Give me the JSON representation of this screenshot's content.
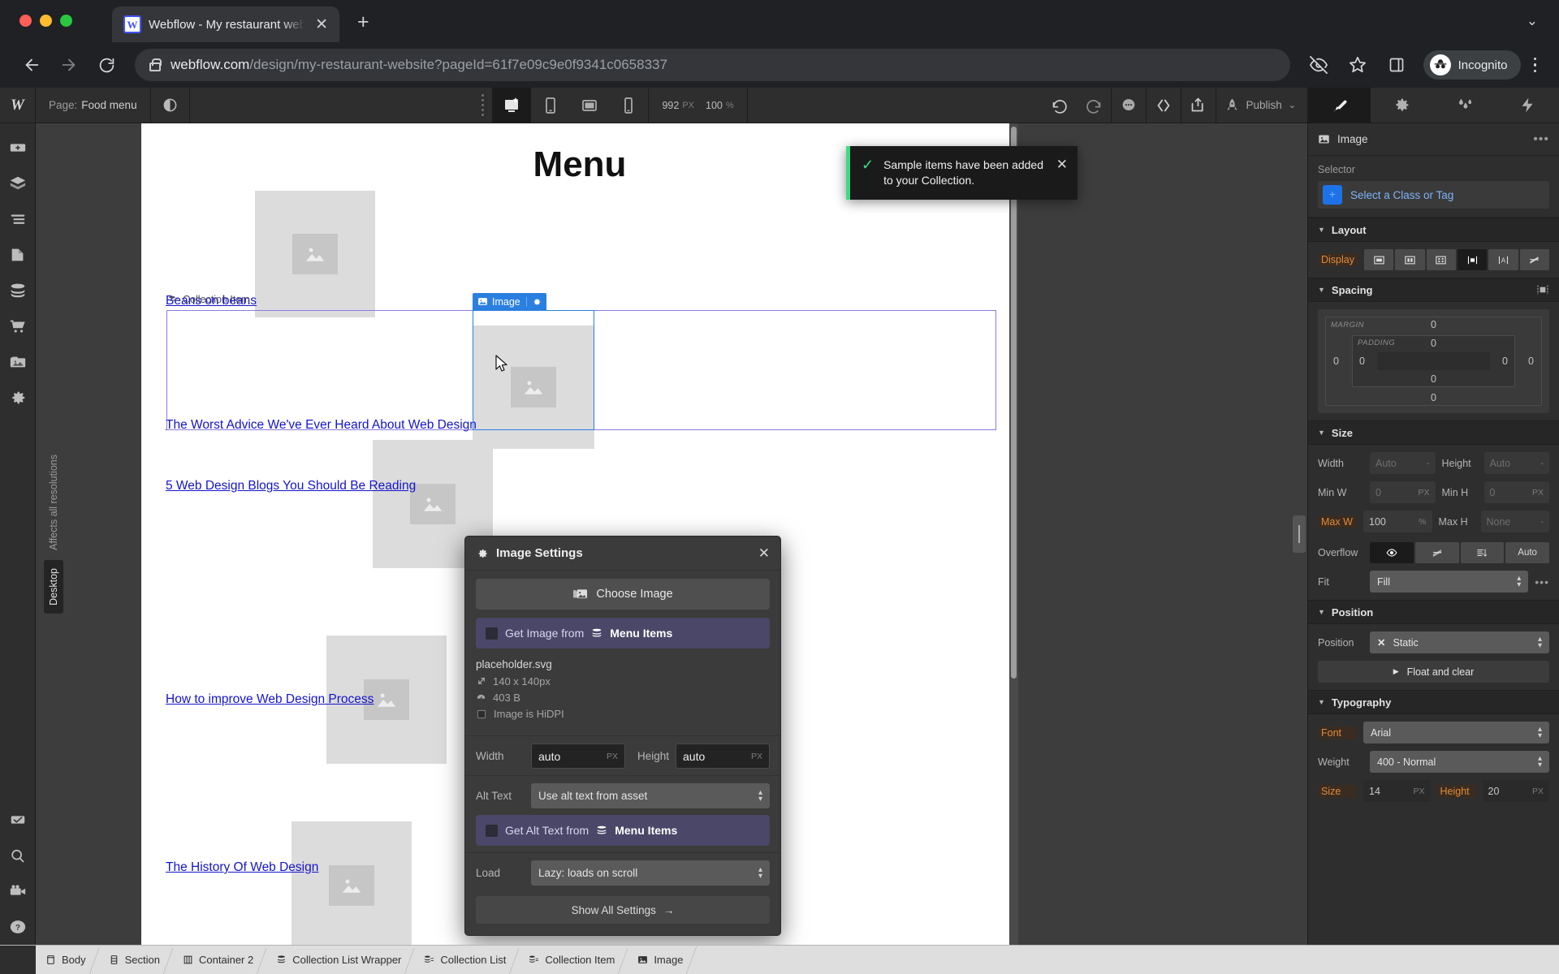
{
  "browser": {
    "tab": {
      "title": "Webflow - My restaurant webs",
      "favicon_letter": "W",
      "close_icon": "✕"
    },
    "new_tab_icon": "+",
    "window_chevron_icon": "⌄",
    "url_domain": "webflow.com",
    "url_path": "/design/my-restaurant-website?pageId=61f7e09c9e0f9341c0658337",
    "profile_label": "Incognito"
  },
  "toolbar": {
    "logo": "W",
    "page_prefix": "Page:",
    "page_name": "Food menu",
    "breakpoints": [
      "desktop",
      "tablet",
      "mobile-landscape",
      "mobile-portrait"
    ],
    "active_breakpoint": "desktop",
    "viewport_width": "992",
    "viewport_width_unit": "PX",
    "zoom": "100",
    "zoom_unit": "%",
    "publish_label": "Publish",
    "panel_tabs": [
      "style-panel",
      "settings-panel",
      "interactions-panel",
      "effects-panel"
    ],
    "active_panel_tab": "style-panel"
  },
  "left_rail": {
    "items": [
      "add-elements",
      "components",
      "navigator",
      "pages",
      "cms-collections",
      "ecommerce",
      "assets",
      "site-settings"
    ],
    "bottom_items": [
      "audit",
      "search",
      "video-tutorials",
      "help"
    ]
  },
  "breakpoint_label": {
    "affects": "Affects all resolutions",
    "current": "Desktop"
  },
  "canvas": {
    "title": "Menu",
    "items": [
      {
        "title": "Beans on beans"
      },
      {
        "title": "The Worst Advice We've Ever Heard About Web Design"
      },
      {
        "title": "5 Web Design Blogs You Should Be Reading"
      },
      {
        "title": "How to improve Web Design Process"
      },
      {
        "title": "The History Of Web Design"
      }
    ],
    "selection_badges": {
      "image": "Image",
      "collection_item": "Collection Item"
    }
  },
  "toast": {
    "message": "Sample items have been added to your Collection.",
    "check_icon": "✓",
    "close_icon": "✕"
  },
  "image_settings": {
    "title": "Image Settings",
    "close_icon": "✕",
    "choose_image_label": "Choose Image",
    "get_image_from_label": "Get Image from",
    "get_image_source": "Menu Items",
    "asset_name": "placeholder.svg",
    "asset_dimensions": "140 x 140px",
    "asset_size": "403 B",
    "hidpi_label": "Image is HiDPI",
    "width_label": "Width",
    "width_value": "auto",
    "width_unit": "PX",
    "height_label": "Height",
    "height_value": "auto",
    "height_unit": "PX",
    "alt_text_label": "Alt Text",
    "alt_text_value": "Use alt text from asset",
    "get_alt_text_label": "Get Alt Text from",
    "get_alt_text_source": "Menu Items",
    "load_label": "Load",
    "load_value": "Lazy: loads on scroll",
    "show_all_label": "Show All Settings",
    "show_all_arrow": "→"
  },
  "style_panel": {
    "element_name": "Image",
    "more_icon": "•••",
    "selector_label": "Selector",
    "selector_placeholder": "Select a Class or Tag",
    "sections": {
      "layout": {
        "title": "Layout",
        "display_label": "Display",
        "display_options": [
          "block",
          "flex",
          "grid",
          "inline-block",
          "inline",
          "none"
        ],
        "display_active": "inline-block"
      },
      "spacing": {
        "title": "Spacing",
        "margin_label": "MARGIN",
        "padding_label": "PADDING",
        "margin": {
          "top": "0",
          "right": "0",
          "bottom": "0",
          "left": "0"
        },
        "padding": {
          "top": "0",
          "right": "0",
          "bottom": "0",
          "left": "0"
        }
      },
      "size": {
        "title": "Size",
        "width_label": "Width",
        "width_value": "Auto",
        "width_unit": "-",
        "height_label": "Height",
        "height_value": "Auto",
        "height_unit": "-",
        "min_w_label": "Min W",
        "min_w_value": "0",
        "min_w_unit": "PX",
        "min_h_label": "Min H",
        "min_h_value": "0",
        "min_h_unit": "PX",
        "max_w_label": "Max W",
        "max_w_value": "100",
        "max_w_unit": "%",
        "max_h_label": "Max H",
        "max_h_value": "None",
        "max_h_unit": "-",
        "overflow_label": "Overflow",
        "overflow_options": [
          "visible",
          "hidden",
          "scroll",
          "Auto"
        ],
        "overflow_active": "visible",
        "fit_label": "Fit",
        "fit_value": "Fill"
      },
      "position": {
        "title": "Position",
        "position_label": "Position",
        "position_value": "Static",
        "float_and_clear_label": "Float and clear"
      },
      "typography": {
        "title": "Typography",
        "font_label": "Font",
        "font_value": "Arial",
        "weight_label": "Weight",
        "weight_value": "400 - Normal",
        "size_label": "Size",
        "size_value": "14",
        "size_unit": "PX",
        "line_height_label": "Height",
        "line_height_value": "20",
        "line_height_unit": "PX"
      }
    }
  },
  "breadcrumb": {
    "items": [
      {
        "label": "Body",
        "icon": "body-icon"
      },
      {
        "label": "Section",
        "icon": "section-icon"
      },
      {
        "label": "Container 2",
        "icon": "container-icon"
      },
      {
        "label": "Collection List Wrapper",
        "icon": "collection-icon"
      },
      {
        "label": "Collection List",
        "icon": "collection-list-icon"
      },
      {
        "label": "Collection Item",
        "icon": "collection-item-icon"
      },
      {
        "label": "Image",
        "icon": "image-icon"
      }
    ]
  },
  "colors": {
    "accent_blue": "#1e72e8",
    "bind_purple": "#4b4768",
    "selection_purple": "#8a7ce0",
    "toast_green": "#3ddc84",
    "override_orange": "#e08a3c"
  }
}
